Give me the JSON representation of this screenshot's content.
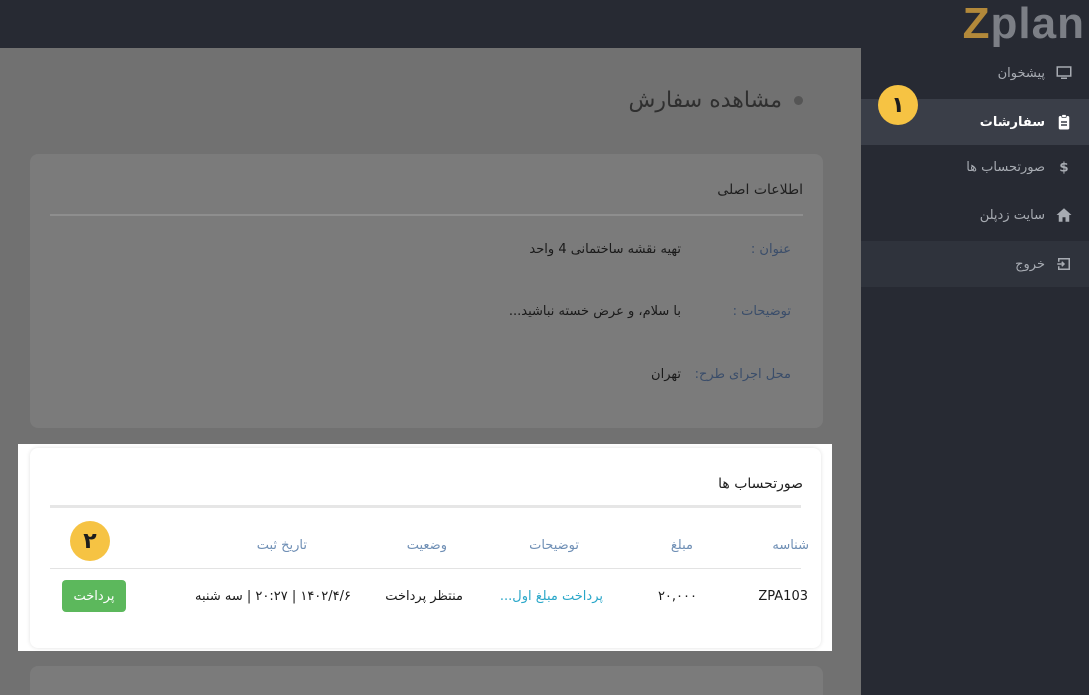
{
  "logo": {
    "z": "Z",
    "rest": "plan"
  },
  "sidebar": {
    "items": [
      {
        "label": "پیشخوان",
        "icon": "monitor-icon"
      },
      {
        "label": "سفارشات",
        "icon": "clipboard-icon",
        "active": true
      },
      {
        "label": "صورتحساب ها",
        "icon": "dollar-icon"
      },
      {
        "label": "سایت زدپلن",
        "icon": "home-icon"
      },
      {
        "label": "خروج",
        "icon": "logout-icon"
      }
    ]
  },
  "badges": {
    "one": "١",
    "two": "٢"
  },
  "page": {
    "title": "مشاهده سفارش"
  },
  "info_card": {
    "title": "اطلاعات اصلی",
    "fields": [
      {
        "label": "عنوان :",
        "value": "تهیه نقشه ساختمانی 4 واحد"
      },
      {
        "label": "توضیحات :",
        "value": "با سلام، و عرض خسته نباشید..."
      },
      {
        "label": "محل اجرای طرح:",
        "value": "تهران"
      }
    ]
  },
  "invoices": {
    "title": "صورتحساب ها",
    "headers": {
      "id": "شناسه",
      "amount": "مبلغ",
      "description": "توضیحات",
      "status": "وضعیت",
      "date": "تاریخ ثبت"
    },
    "rows": [
      {
        "id": "ZPA103",
        "amount": "۲۰,۰۰۰",
        "description": "پرداخت مبلغ اول...",
        "status": "منتظر پرداخت",
        "date": "۱۴۰۲/۴/۶ | ۲۰:۲۷ | سه شنبه",
        "action": "پرداخت"
      }
    ]
  },
  "colors": {
    "accent_badge": "#f6c343",
    "pay_button": "#5cb85c",
    "sidebar_bg": "#272a33",
    "link": "#2aa7c9"
  }
}
